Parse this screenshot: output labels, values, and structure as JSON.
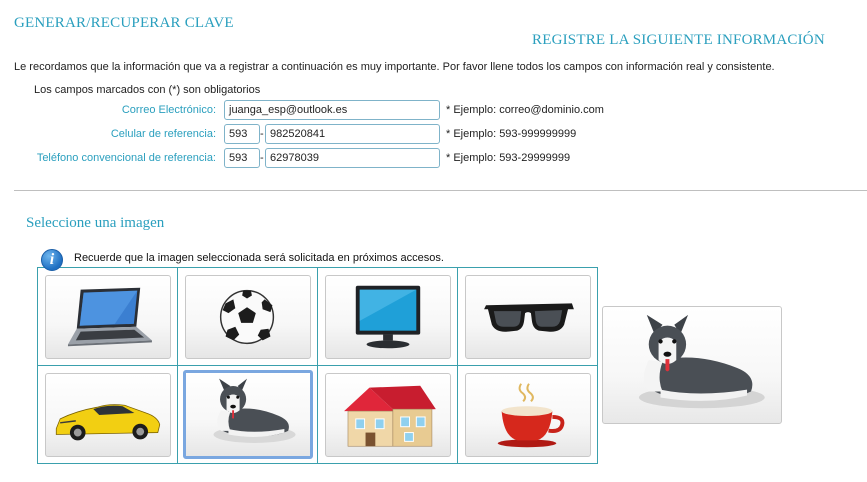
{
  "header": {
    "title": "GENERAR/RECUPERAR CLAVE",
    "section_title": "REGISTRE LA SIGUIENTE INFORMACIÓN"
  },
  "intro": "Le recordamos que la información que va a registrar a continuación es muy importante. Por favor llene todos los campos con información real y consistente.",
  "required_note": "Los campos marcados con (*) son obligatorios",
  "form": {
    "email": {
      "label": "Correo Electrónico:",
      "value": "juanga_esp@outlook.es",
      "example": "* Ejemplo: correo@dominio.com"
    },
    "cell_phone": {
      "label": "Celular de referencia:",
      "prefix": "593",
      "separator": "-",
      "number": "982520841",
      "example": "* Ejemplo: 593-999999999"
    },
    "landline": {
      "label": "Teléfono convencional de referencia:",
      "prefix": "593",
      "separator": "-",
      "number": "62978039",
      "example": "* Ejemplo: 593-29999999"
    }
  },
  "image_section": {
    "title": "Seleccione una imagen",
    "info_icon": "info-icon",
    "info_icon_glyph": "i",
    "reminder": "Recuerde que la imagen seleccionada será solicitada en próximos accesos.",
    "options": [
      {
        "icon": "laptop-icon",
        "selected": false
      },
      {
        "icon": "soccer-ball-icon",
        "selected": false
      },
      {
        "icon": "monitor-icon",
        "selected": false
      },
      {
        "icon": "sunglasses-icon",
        "selected": false
      },
      {
        "icon": "sports-car-icon",
        "selected": false
      },
      {
        "icon": "husky-dog-icon",
        "selected": true
      },
      {
        "icon": "house-icon",
        "selected": false
      },
      {
        "icon": "coffee-cup-icon",
        "selected": false
      }
    ],
    "preview_icon": "husky-dog-icon"
  },
  "colors": {
    "accent": "#2a9fbe",
    "grid_border": "#3aa0ad",
    "selected_border": "#7aa7e0",
    "field_border": "#7fb3c9"
  }
}
